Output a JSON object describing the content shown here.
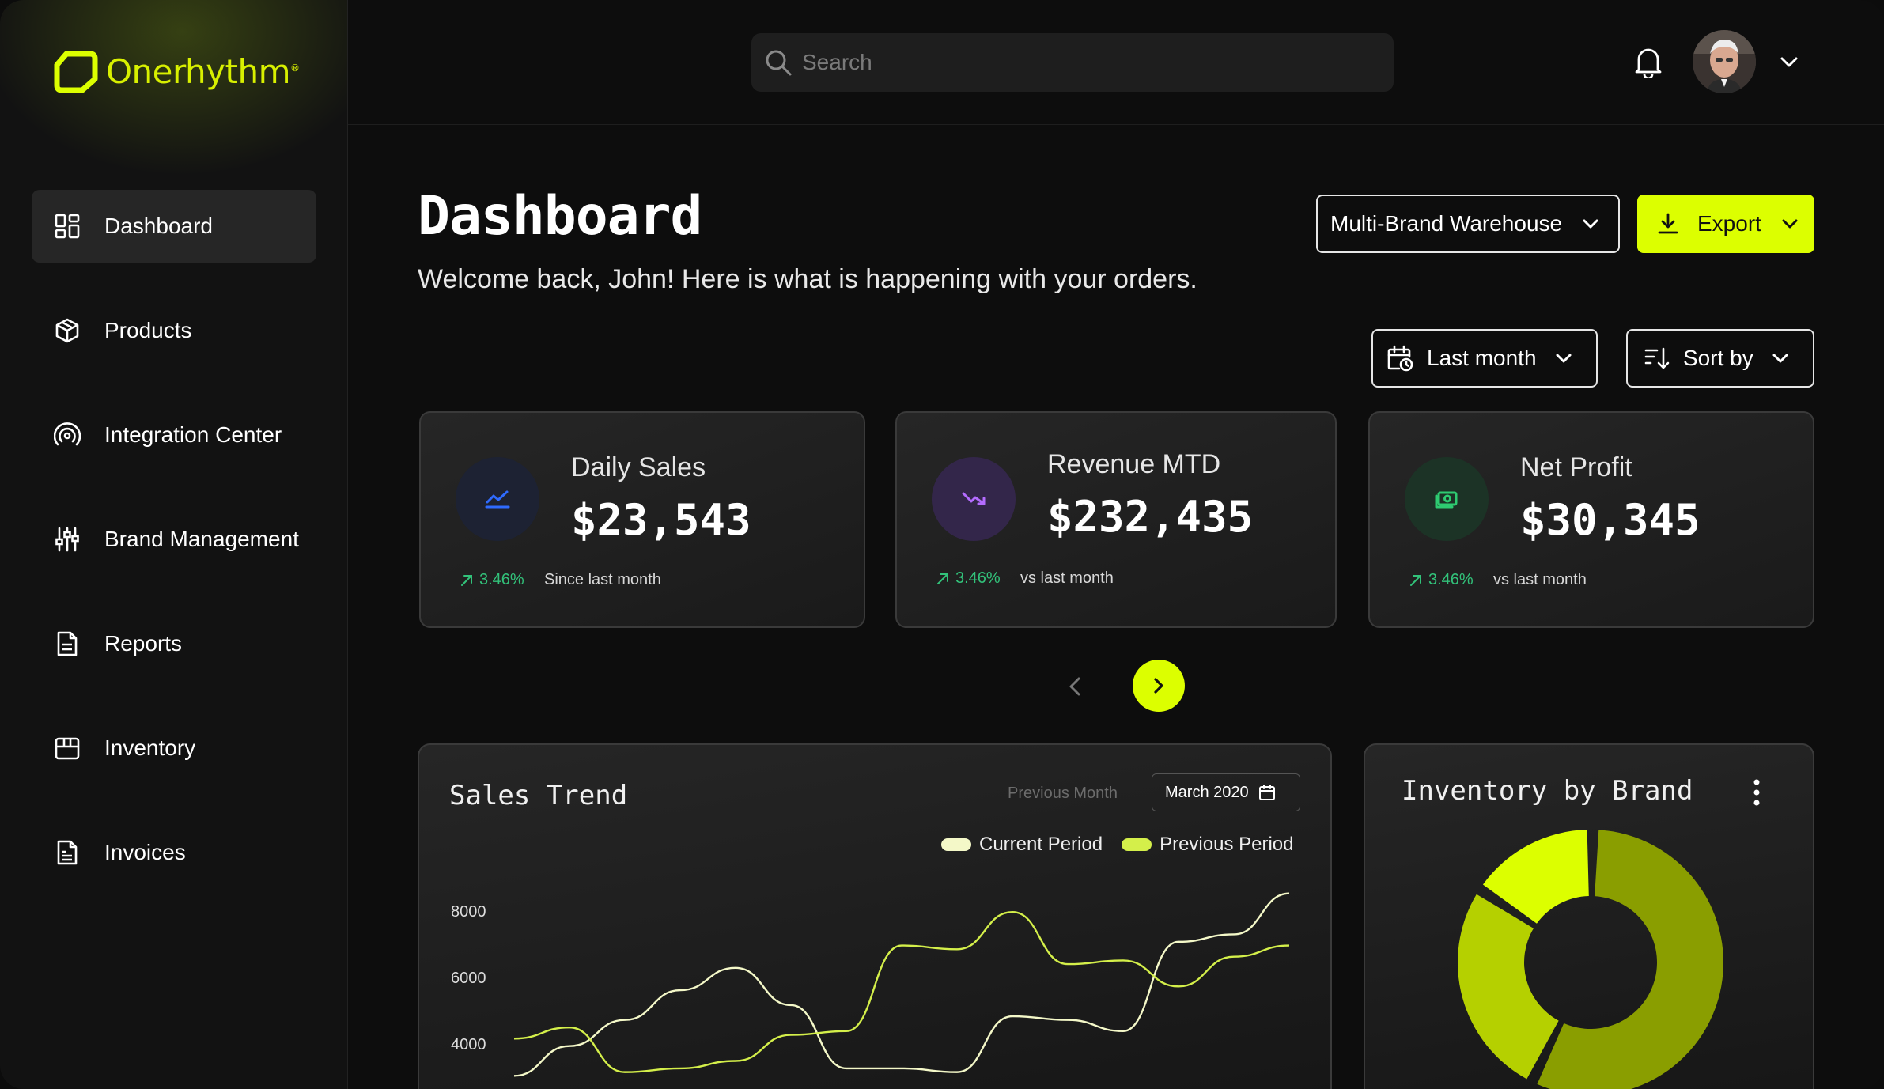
{
  "brand": {
    "name": "Onerhythm",
    "mark": "®",
    "accent": "#dcff00"
  },
  "sidebar": {
    "items": [
      {
        "label": "Dashboard",
        "icon": "dashboard-icon",
        "active": true
      },
      {
        "label": "Products",
        "icon": "box-icon",
        "active": false
      },
      {
        "label": "Integration Center",
        "icon": "broadcast-icon",
        "active": false
      },
      {
        "label": "Brand Management",
        "icon": "sliders-icon",
        "active": false
      },
      {
        "label": "Reports",
        "icon": "document-icon",
        "active": false
      },
      {
        "label": "Inventory",
        "icon": "inventory-icon",
        "active": false
      },
      {
        "label": "Invoices",
        "icon": "invoice-icon",
        "active": false
      }
    ]
  },
  "topbar": {
    "search_placeholder": "Search"
  },
  "header": {
    "title": "Dashboard",
    "subtitle": "Welcome back, John! Here is what is happening with your orders.",
    "warehouse": "Multi-Brand Warehouse",
    "export_label": "Export",
    "period": "Last month",
    "sort_label": "Sort by"
  },
  "kpis": [
    {
      "label": "Daily Sales",
      "value": "$23,543",
      "trend": "3.46%",
      "note": "Since last month",
      "icon": "chart-line-icon",
      "icon_color": "#2f6bff",
      "bg": "#1d2233"
    },
    {
      "label": "Revenue MTD",
      "value": "$232,435",
      "trend": "3.46%",
      "note": "vs last month",
      "icon": "trend-down-icon",
      "icon_color": "#b46cff",
      "bg": "#33264a"
    },
    {
      "label": "Net Profit",
      "value": "$30,345",
      "trend": "3.46%",
      "note": "vs last month",
      "icon": "cash-icon",
      "icon_color": "#2ecc71",
      "bg": "#1c3326"
    }
  ],
  "sales_trend": {
    "title": "Sales Trend",
    "compare_label": "Previous Month",
    "month": "March 2020"
  },
  "inventory": {
    "title": "Inventory by Brand"
  },
  "chart_data": [
    {
      "type": "line",
      "title": "Sales Trend",
      "y_ticks": [
        8000,
        6000,
        4000
      ],
      "ylim": [
        2500,
        9000
      ],
      "x": [
        0,
        1,
        2,
        3,
        4,
        5,
        6,
        7,
        8,
        9,
        10,
        11,
        12,
        13,
        14
      ],
      "series": [
        {
          "name": "Current Period",
          "color": "#f4f8c8",
          "values": [
            3300,
            4100,
            4800,
            5600,
            6200,
            5200,
            3500,
            3500,
            3400,
            4900,
            4800,
            4500,
            6900,
            7100,
            8200
          ]
        },
        {
          "name": "Previous Period",
          "color": "#d4ef4a",
          "values": [
            4300,
            4600,
            3400,
            3500,
            3700,
            4400,
            4500,
            6800,
            6700,
            7700,
            6300,
            6400,
            5700,
            6500,
            6800
          ]
        }
      ],
      "legend": "top-right",
      "grid": false
    },
    {
      "type": "pie",
      "title": "Inventory by Brand",
      "slices": [
        {
          "value": 57,
          "color": "#8a9e00"
        },
        {
          "value": 27,
          "color": "#b5d000"
        },
        {
          "value": 16,
          "color": "#dcff00"
        }
      ]
    }
  ]
}
